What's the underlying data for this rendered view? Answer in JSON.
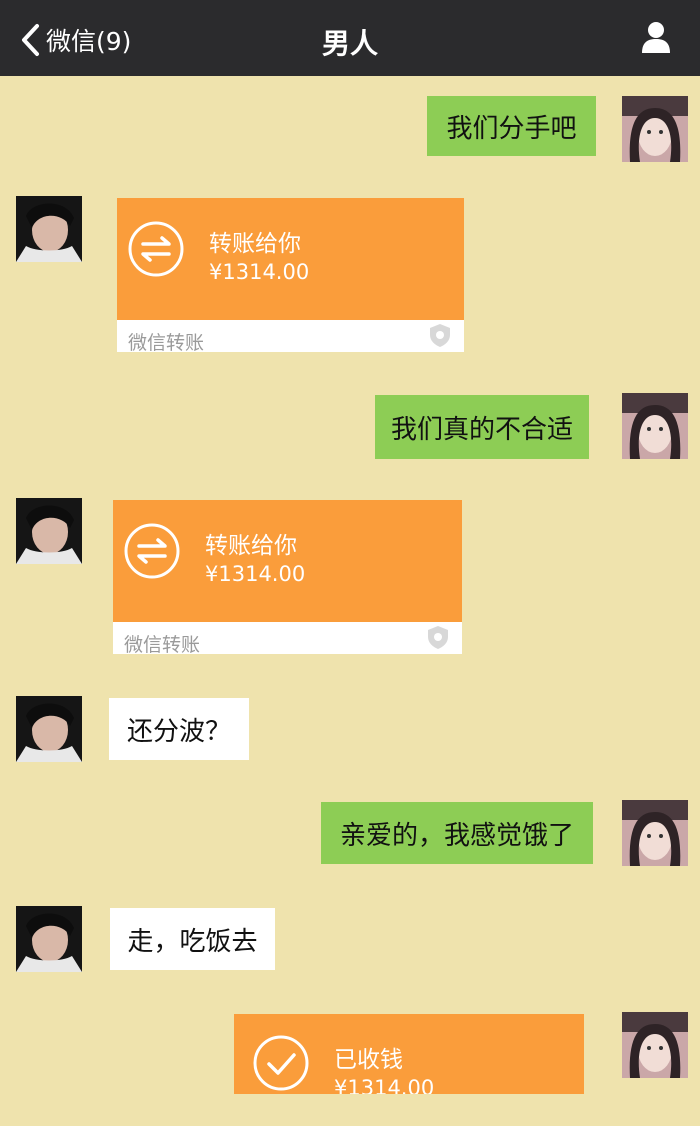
{
  "header": {
    "back_label": "微信(9)",
    "title": "男人"
  },
  "messages": [
    {
      "from": "me",
      "type": "text",
      "text": "我们分手吧"
    },
    {
      "from": "them",
      "type": "transfer",
      "title": "转账给你",
      "amount": "¥1314.00",
      "footer": "微信转账"
    },
    {
      "from": "me",
      "type": "text",
      "text": "我们真的不合适"
    },
    {
      "from": "them",
      "type": "transfer",
      "title": "转账给你",
      "amount": "¥1314.00",
      "footer": "微信转账"
    },
    {
      "from": "them",
      "type": "text",
      "text": "还分波？"
    },
    {
      "from": "me",
      "type": "text",
      "text": "亲爱的，我感觉饿了"
    },
    {
      "from": "them",
      "type": "text",
      "text": "走，吃饭去"
    },
    {
      "from": "me",
      "type": "transfer-received",
      "title": "已收钱",
      "amount": "¥1314.00"
    }
  ],
  "colors": {
    "chat_background": "#efe3ad",
    "header_background": "#2b2b2d",
    "my_bubble": "#8dcd55",
    "their_bubble": "#ffffff",
    "transfer_orange": "#fa9d3b"
  },
  "icons": {
    "back": "chevron-left-icon",
    "profile": "person-icon",
    "transfer": "transfer-arrows-icon",
    "received": "checkmark-icon",
    "footer_badge": "shield-icon"
  }
}
